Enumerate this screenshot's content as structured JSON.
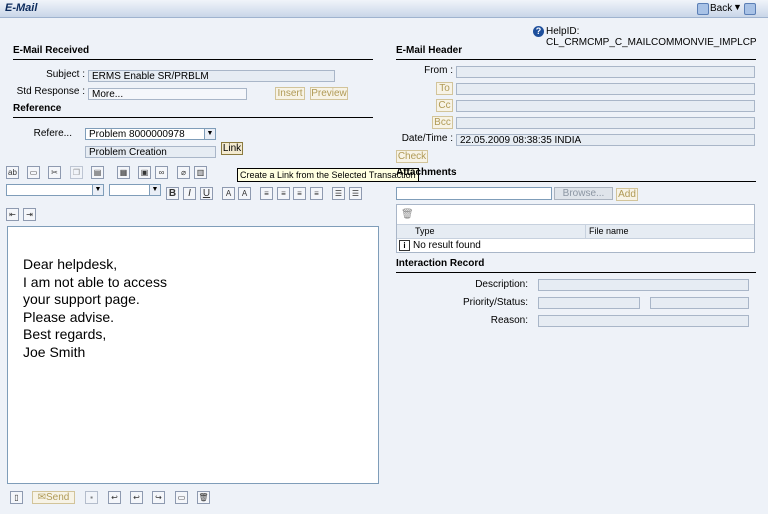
{
  "window": {
    "title": "E-Mail",
    "back_label": "Back"
  },
  "help": {
    "text": "HelpID: CL_CRMCMP_C_MAILCOMMONVIE_IMPLCP"
  },
  "email_received": {
    "section_title": "E-Mail Received",
    "subject_label": "Subject :",
    "subject_value": "ERMS Enable SR/PRBLM",
    "std_response_label": "Std Response :",
    "std_response_value": "More...",
    "insert_label": "Insert",
    "preview_label": "Preview"
  },
  "reference": {
    "section_title": "Reference",
    "label": "Refere...",
    "value": "Problem 8000000978",
    "description": "Problem Creation",
    "link_label": "Link"
  },
  "tooltip": {
    "text": "Create a Link from the Selected Transaction"
  },
  "editor": {
    "body_lines": [
      "Dear helpdesk,",
      "I am not able to access",
      "your support page.",
      "Please advise.",
      "Best regards,",
      "Joe Smith"
    ]
  },
  "bottom_toolbar": {
    "send_label": "Send"
  },
  "email_header": {
    "section_title": "E-Mail Header",
    "from_label": "From :",
    "to_label": "To",
    "cc_label": "Cc",
    "bcc_label": "Bcc",
    "datetime_label": "Date/Time :",
    "datetime_value": "22.05.2009 08:38:35 INDIA",
    "check_label": "Check"
  },
  "attachments": {
    "section_title": "Attachments",
    "browse_label": "Browse...",
    "add_label": "Add",
    "columns": [
      "Type",
      "File name"
    ],
    "empty_text": "No result found"
  },
  "interaction_record": {
    "section_title": "Interaction Record",
    "description_label": "Description:",
    "priority_label": "Priority/Status:",
    "reason_label": "Reason:"
  },
  "icons": {
    "help": "?",
    "info": "i"
  }
}
